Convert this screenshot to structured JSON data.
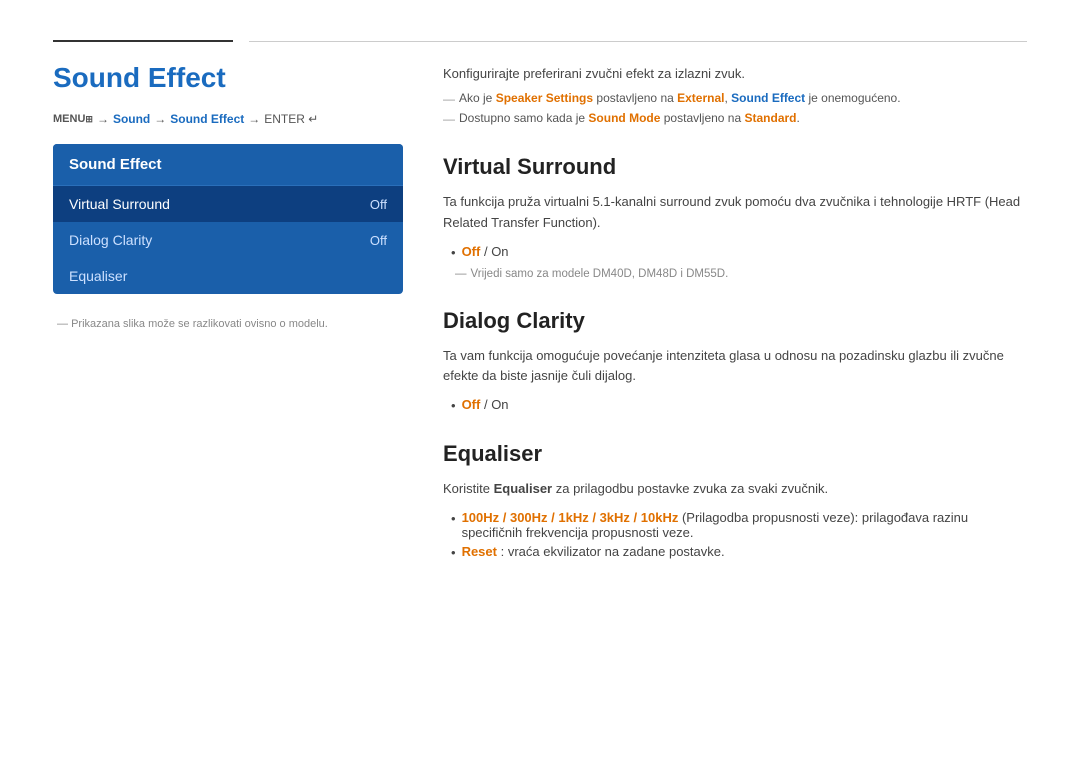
{
  "page": {
    "title": "Sound Effect",
    "breadcrumb": {
      "menu_symbol": "MENU",
      "menu_symbol_extra": "III",
      "items": [
        "Sound",
        "Sound Effect"
      ],
      "enter": "ENTER"
    },
    "footnote": "Prikazana slika može se razlikovati ovisno o modelu."
  },
  "menu_panel": {
    "header": "Sound Effect",
    "items": [
      {
        "label": "Virtual Surround",
        "value": "Off",
        "selected": true
      },
      {
        "label": "Dialog Clarity",
        "value": "Off",
        "selected": false
      },
      {
        "label": "Equaliser",
        "value": "",
        "selected": false
      }
    ]
  },
  "right_column": {
    "intro": "Konfigurirajte preferirani zvučni efekt za izlazni zvuk.",
    "note1_dash": "—",
    "note1_pre": "Ako je ",
    "note1_highlight1": "Speaker Settings",
    "note1_mid": " postavljeno na ",
    "note1_highlight2": "External",
    "note1_post_pre": ", ",
    "note1_highlight3": "Sound Effect",
    "note1_post": " je onemogućeno.",
    "note2_dash": "—",
    "note2_pre": "Dostupno samo kada je ",
    "note2_highlight": "Sound Mode",
    "note2_mid": " postavljeno na ",
    "note2_highlight2": "Standard",
    "note2_post": ".",
    "sections": [
      {
        "id": "virtual-surround",
        "title": "Virtual Surround",
        "body": "Ta funkcija pruža virtualni 5.1-kanalni surround zvuk pomoću dva zvučnika i tehnologije HRTF (Head Related Transfer Function).",
        "bullet": {
          "pre": "",
          "opt1": "Off",
          "sep": " / ",
          "opt2": "On"
        },
        "sub_note_dash": "—",
        "sub_note": "Vrijedi samo za modele DM40D, DM48D i DM55D."
      },
      {
        "id": "dialog-clarity",
        "title": "Dialog Clarity",
        "body": "Ta vam funkcija omogućuje povećanje intenziteta glasa u odnosu na pozadinsku glazbu ili zvučne efekte da biste jasnije čuli dijalog.",
        "bullet": {
          "pre": "",
          "opt1": "Off",
          "sep": " / ",
          "opt2": "On"
        },
        "sub_note_dash": null,
        "sub_note": null
      },
      {
        "id": "equaliser",
        "title": "Equaliser",
        "body_pre": "Koristite ",
        "body_highlight": "Equaliser",
        "body_post": " za prilagodbu postavke zvuka za svaki zvučnik.",
        "bullets": [
          {
            "highlight": "100Hz / 300Hz / 1kHz / 3kHz / 10kHz",
            "text": " (Prilagodba propusnosti veze): prilagođava razinu specifičnih frekvencija propusnosti veze."
          },
          {
            "highlight": "Reset",
            "text": ": vraća ekvilizator na zadane postavke."
          }
        ]
      }
    ]
  }
}
